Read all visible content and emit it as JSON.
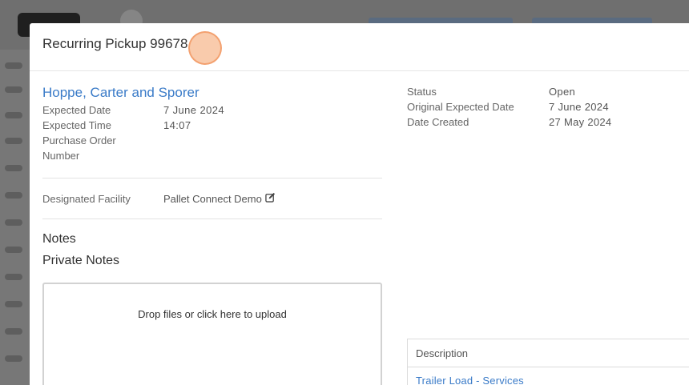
{
  "modal": {
    "title": "Recurring Pickup 99678"
  },
  "left": {
    "client_name": "Hoppe, Carter and Sporer",
    "fields": [
      {
        "label": "Expected Date",
        "value": "7 June 2024"
      },
      {
        "label": "Expected Time",
        "value": "14:07"
      },
      {
        "label": "Purchase Order Number",
        "value": ""
      }
    ],
    "facility": {
      "label": "Designated Facility",
      "value": "Pallet Connect Demo"
    },
    "notes_heading": "Notes",
    "private_notes_heading": "Private Notes",
    "dropzone_text": "Drop files or click here to upload"
  },
  "right": {
    "fields": [
      {
        "label": "Status",
        "value": "Open"
      },
      {
        "label": "Original Expected Date",
        "value": "7 June 2024"
      },
      {
        "label": "Date Created",
        "value": "27 May 2024"
      }
    ]
  },
  "items_table": {
    "header": "Description",
    "rows": [
      {
        "description": "Trailer Load - Services"
      }
    ]
  },
  "icons": {
    "edit": "edit-icon"
  },
  "colors": {
    "link": "#3a7bc8",
    "overlay": "#7d7d7d",
    "cursor_highlight": "#f4a068"
  }
}
